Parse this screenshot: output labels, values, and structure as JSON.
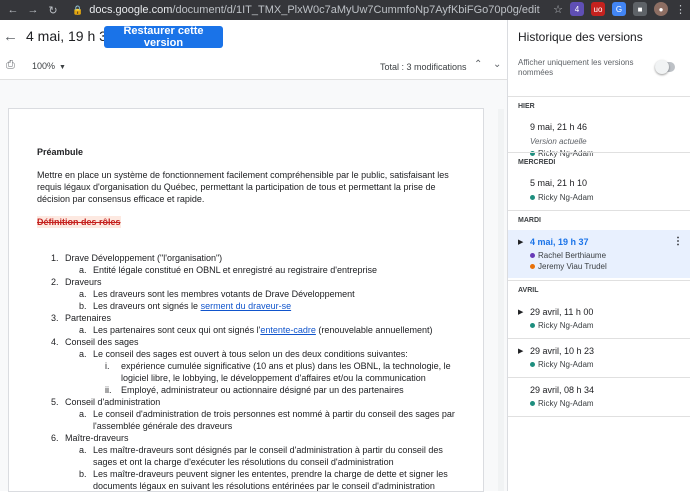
{
  "browser": {
    "url_host": "docs.google.com",
    "url_path": "/document/d/1IT_TMX_PlxW0c7aMyUw7CummfoNp7AyfKbiFGo70p0g/edit",
    "badge_count": "4",
    "ext_label": "uo"
  },
  "header": {
    "title": "4 mai, 19 h 37",
    "restore_label": "Restaurer cette version"
  },
  "toolbar": {
    "zoom": "100%",
    "total": "Total : 3 modifications"
  },
  "doc": {
    "heading": "Préambule",
    "intro": "Mettre en place un système de fonctionnement facilement compréhensible par le public, satisfaisant les requis légaux d'organisation du Québec, permettant la participation de tous et permettant la prise de décision par consensus efficace et rapide.",
    "deleted_heading": "Définition des rôles",
    "items": [
      {
        "num": "1.",
        "text": "Drave Développement (\"l'organisation\")",
        "subs": [
          {
            "num": "a.",
            "text": "Entité légale constitué en OBNL et enregistré au registraire d'entreprise"
          }
        ]
      },
      {
        "num": "2.",
        "text": "Draveurs",
        "subs": [
          {
            "num": "a.",
            "text": "Les draveurs sont les membres votants de Drave Développement"
          },
          {
            "num": "b.",
            "text_before": "Les draveurs ont signés le ",
            "link": "serment du draveur-se",
            "text_after": ""
          }
        ]
      },
      {
        "num": "3.",
        "text": "Partenaires",
        "subs": [
          {
            "num": "a.",
            "text_before": "Les partenaires sont ceux qui ont signés l'",
            "link": "entente-cadre",
            "text_after": " (renouvelable annuellement)"
          }
        ]
      },
      {
        "num": "4.",
        "text": "Conseil des sages",
        "subs": [
          {
            "num": "a.",
            "text": "Le conseil des sages est ouvert à tous selon un des deux conditions suivantes:"
          }
        ],
        "subsubs": [
          {
            "num": "i.",
            "text": "expérience cumulée significative (10 ans et plus) dans les OBNL, la technologie, le logiciel libre, le lobbying, le développement d'affaires et/ou la communication"
          },
          {
            "num": "ii.",
            "text": "Employé, administrateur ou actionnaire désigné par un des partenaires"
          }
        ]
      },
      {
        "num": "5.",
        "text": "Conseil d'administration",
        "subs": [
          {
            "num": "a.",
            "text": "Le conseil d'administration de trois personnes est nommé à partir du conseil des sages par l'assemblée générale des draveurs"
          }
        ]
      },
      {
        "num": "6.",
        "text": "Maître-draveurs",
        "subs": [
          {
            "num": "a.",
            "text": "Les maître-draveurs sont désignés par le conseil d'administration à partir du conseil des sages et ont la charge d'exécuter les résolutions du conseil d'administration"
          },
          {
            "num": "b.",
            "text": "Les maître-draveurs peuvent signer les ententes, prendre la charge de dette et signer les documents légaux en suivant les résolutions entérinées par le conseil d'administration"
          }
        ]
      }
    ]
  },
  "sidebar": {
    "title": "Historique des versions",
    "toggle_label": "Afficher uniquement les versions nommées",
    "sections": [
      {
        "label": "HIER"
      },
      {
        "label": "MERCREDI"
      },
      {
        "label": "MARDI"
      },
      {
        "label": "AVRIL"
      }
    ],
    "versions": [
      {
        "date": "9 mai, 21 h 46",
        "sub": "Version actuelle",
        "users": [
          {
            "name": "Ricky Ng-Adam",
            "color": "#1e8e7e"
          }
        ]
      },
      {
        "date": "5 mai, 21 h 10",
        "users": [
          {
            "name": "Ricky Ng-Adam",
            "color": "#1e8e7e"
          }
        ]
      },
      {
        "date": "4 mai, 19 h 37",
        "users": [
          {
            "name": "Rachel Berthiaume",
            "color": "#673ab7"
          },
          {
            "name": "Jeremy Viau Trudel",
            "color": "#e8710a"
          }
        ]
      },
      {
        "date": "29 avril, 11 h 00",
        "users": [
          {
            "name": "Ricky Ng-Adam",
            "color": "#1e8e7e"
          }
        ]
      },
      {
        "date": "29 avril, 10 h 23",
        "users": [
          {
            "name": "Ricky Ng-Adam",
            "color": "#1e8e7e"
          }
        ]
      },
      {
        "date": "29 avril, 08 h 34",
        "users": [
          {
            "name": "Ricky Ng-Adam",
            "color": "#1e8e7e"
          }
        ]
      }
    ]
  },
  "colors": {
    "accent": "#1a73e8",
    "selected_bg": "#e8f0fe",
    "deleted": "#c5221f"
  }
}
